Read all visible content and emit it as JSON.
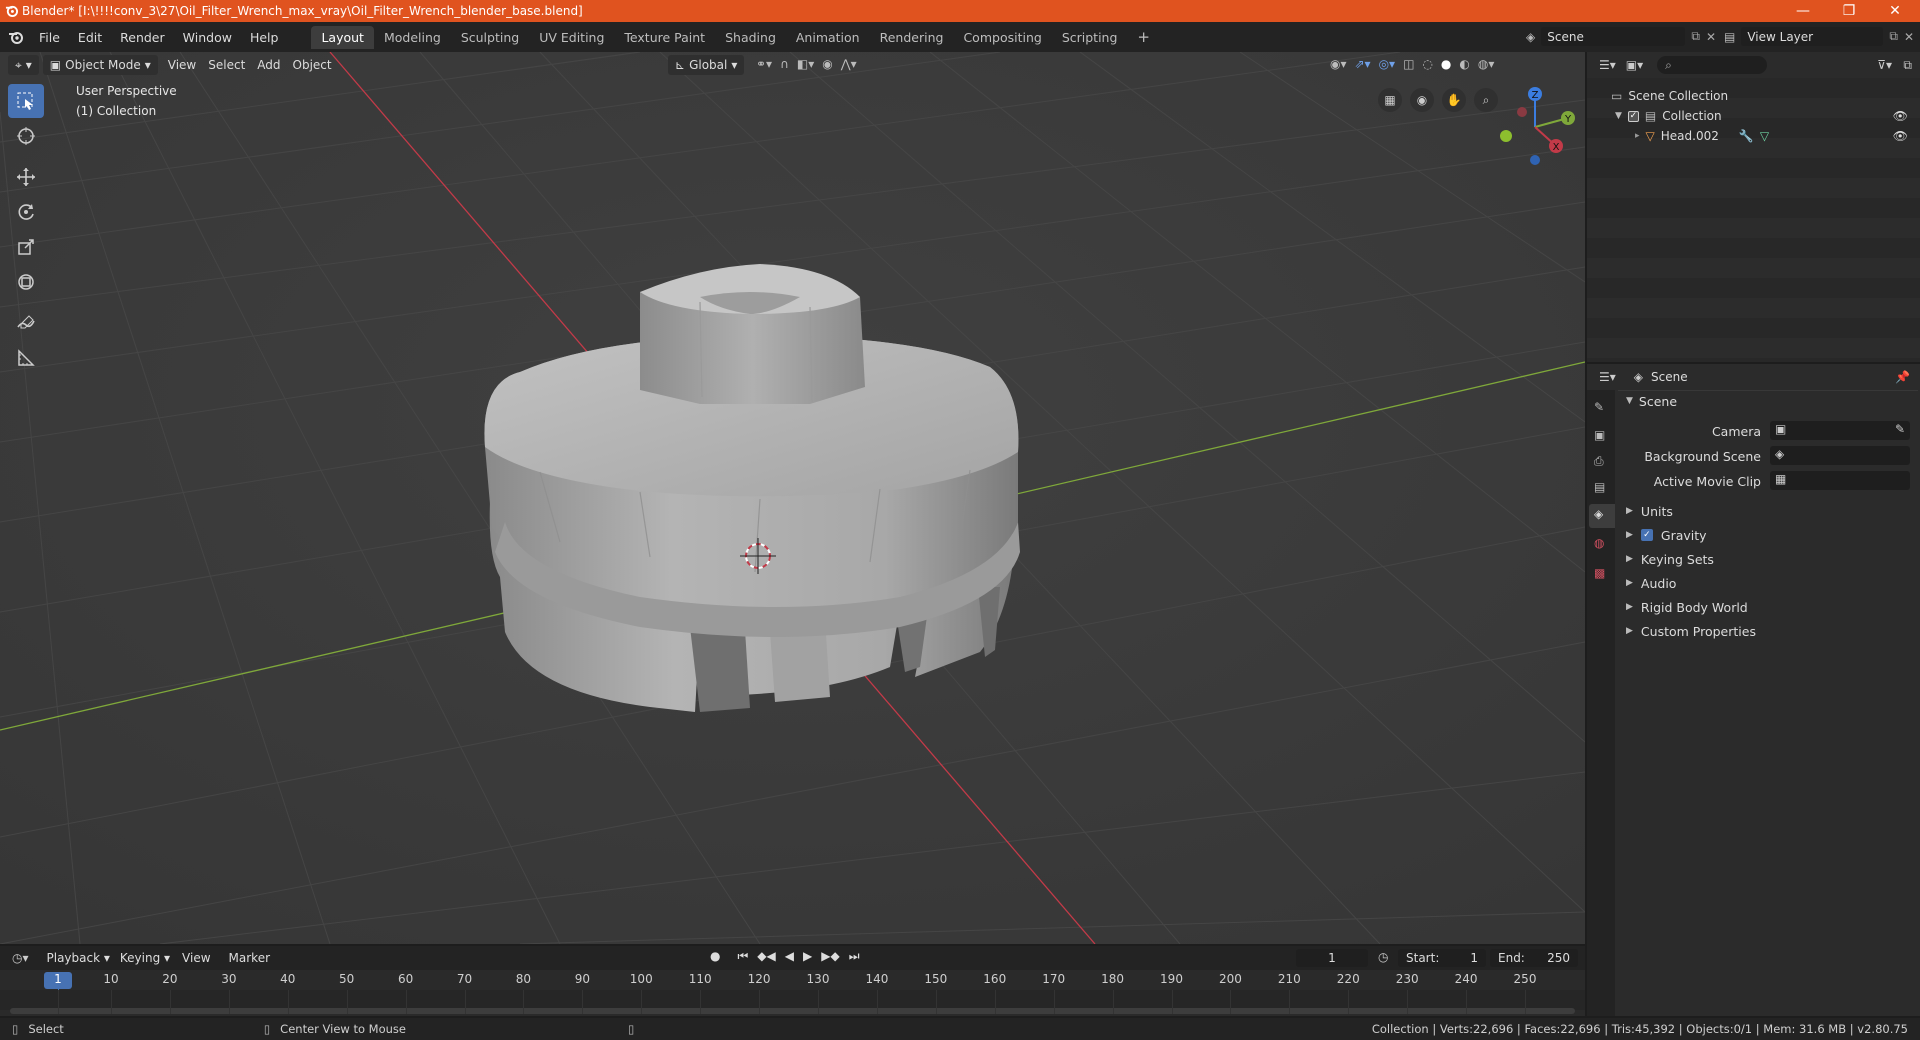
{
  "window": {
    "title": "Blender* [I:\\!!!!conv_3\\27\\Oil_Filter_Wrench_max_vray\\Oil_Filter_Wrench_blender_base.blend]",
    "minimize": "—",
    "maximize": "❐",
    "close": "✕"
  },
  "menu": [
    "File",
    "Edit",
    "Render",
    "Window",
    "Help"
  ],
  "workspaces": [
    "Layout",
    "Modeling",
    "Sculpting",
    "UV Editing",
    "Texture Paint",
    "Shading",
    "Animation",
    "Rendering",
    "Compositing",
    "Scripting"
  ],
  "workspace_add": "+",
  "scene_selector": "Scene",
  "view_layer_selector": "View Layer",
  "viewport_header": {
    "mode": "Object Mode",
    "menus": [
      "View",
      "Select",
      "Add",
      "Object"
    ],
    "orientation": "Global"
  },
  "viewport_overlay": {
    "perspective": "User Perspective",
    "collection": "(1) Collection"
  },
  "gizmo_axes": {
    "z": "Z",
    "y": "Y",
    "x": "X"
  },
  "outliner": {
    "search_placeholder": "",
    "scene_collection": "Scene Collection",
    "collection": "Collection",
    "object": "Head.002"
  },
  "properties": {
    "context_label": "Scene",
    "panel_title": "Scene",
    "camera_label": "Camera",
    "background_scene_label": "Background Scene",
    "active_movie_clip_label": "Active Movie Clip",
    "sections": [
      "Units",
      "Gravity",
      "Keying Sets",
      "Audio",
      "Rigid Body World",
      "Custom Properties"
    ]
  },
  "timeline": {
    "menus": [
      "Playback",
      "Keying",
      "View",
      "Marker"
    ],
    "current_frame": "1",
    "start_label": "Start:",
    "start_value": "1",
    "end_label": "End:",
    "end_value": "250",
    "ticks": [
      "1",
      "10",
      "20",
      "30",
      "40",
      "50",
      "60",
      "70",
      "80",
      "90",
      "100",
      "110",
      "120",
      "130",
      "140",
      "150",
      "160",
      "170",
      "180",
      "190",
      "200",
      "210",
      "220",
      "230",
      "240",
      "250"
    ]
  },
  "statusbar": {
    "select": "Select",
    "center_view": "Center View to Mouse",
    "stats": "Collection | Verts:22,696 | Faces:22,696 | Tris:45,392 | Objects:0/1 | Mem: 31.6 MB | v2.80.75"
  },
  "colors": {
    "titlebar": "#e0531f",
    "accent": "#4772b3",
    "x_axis": "#c23a48",
    "y_axis": "#7fa83a"
  }
}
